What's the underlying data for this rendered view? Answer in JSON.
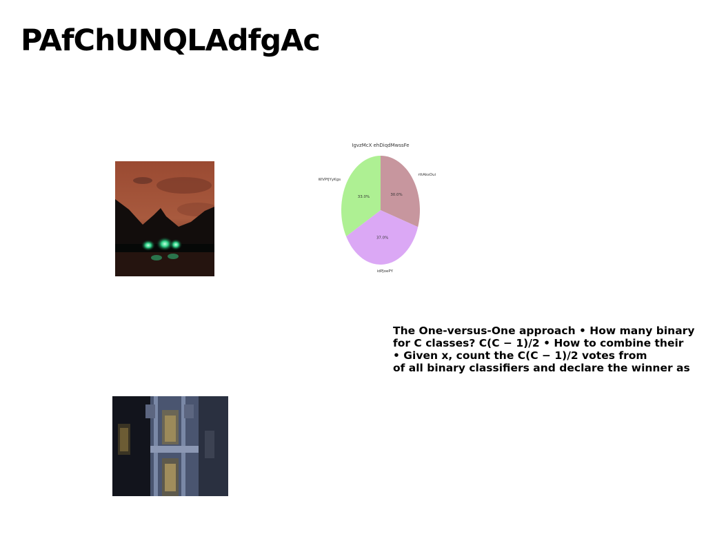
{
  "page": {
    "title": "PAfChUNQLAdfgAc",
    "text_lines": [
      "The One-versus-One approach • How many binary",
      "for C classes? C(C − 1)/2 • How to combine their",
      "• Given x, count the C(C − 1)/2 votes from",
      "of all binary classifiers and declare the winner as"
    ]
  },
  "images": {
    "mountain": {
      "alt": "night mountain lake with green light trails"
    },
    "building": {
      "alt": "ornate stone building facade with windows"
    }
  },
  "chart_data": {
    "type": "pie",
    "title": "IgvzMcX ehDiqdMwssFe",
    "slices": [
      {
        "label": "rttAksOui",
        "value": 30.0,
        "display": "30.0%",
        "color": "#c7969e"
      },
      {
        "label": "idPJoePY",
        "value": 37.0,
        "display": "37.0%",
        "color": "#dba8f5"
      },
      {
        "label": "WVPfjYyKgs",
        "value": 33.0,
        "display": "33.0%",
        "color": "#aef093"
      }
    ],
    "start_angle_deg": 90,
    "direction": "clockwise"
  }
}
